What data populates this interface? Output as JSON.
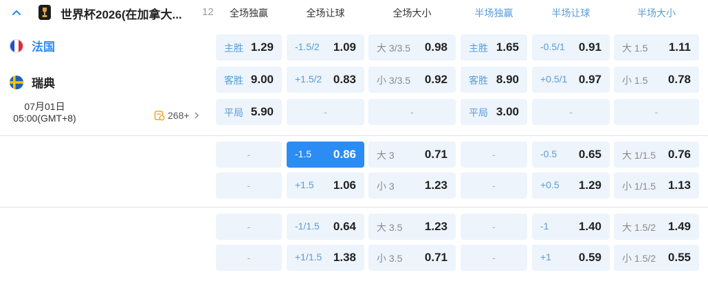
{
  "header": {
    "league": "世界杯2026(在加拿大...",
    "count": "12",
    "columns": [
      {
        "label": "全场独赢",
        "color": "#333333"
      },
      {
        "label": "全场让球",
        "color": "#333333"
      },
      {
        "label": "全场大小",
        "color": "#333333"
      },
      {
        "label": "半场独赢",
        "color": "#5b9bd5"
      },
      {
        "label": "半场让球",
        "color": "#5b9bd5"
      },
      {
        "label": "半场大小",
        "color": "#5b9bd5"
      }
    ]
  },
  "match": {
    "home": "法国",
    "away": "瑞典",
    "date": "07月01日",
    "time": "05:00(GMT+8)",
    "more_count": "268+"
  },
  "dash": "-",
  "rows": [
    [
      {
        "label": "主胜",
        "odd": "1.29"
      },
      {
        "label": "-1.5/2",
        "odd": "1.09"
      },
      {
        "label": "大 3/3.5",
        "odd": "0.98",
        "gray": true
      },
      {
        "label": "主胜",
        "odd": "1.65"
      },
      {
        "label": "-0.5/1",
        "odd": "0.91"
      },
      {
        "label": "大 1.5",
        "odd": "1.11",
        "gray": true
      }
    ],
    [
      {
        "label": "客胜",
        "odd": "9.00"
      },
      {
        "label": "+1.5/2",
        "odd": "0.83"
      },
      {
        "label": "小 3/3.5",
        "odd": "0.92",
        "gray": true
      },
      {
        "label": "客胜",
        "odd": "8.90"
      },
      {
        "label": "+0.5/1",
        "odd": "0.97"
      },
      {
        "label": "小 1.5",
        "odd": "0.78",
        "gray": true
      }
    ],
    [
      {
        "label": "平局",
        "odd": "5.90"
      },
      null,
      null,
      {
        "label": "平局",
        "odd": "3.00"
      },
      null,
      null
    ],
    [
      null,
      {
        "label": "-1.5",
        "odd": "0.86",
        "active": true
      },
      {
        "label": "大 3",
        "odd": "0.71",
        "gray": true
      },
      null,
      {
        "label": "-0.5",
        "odd": "0.65"
      },
      {
        "label": "大 1/1.5",
        "odd": "0.76",
        "gray": true
      }
    ],
    [
      null,
      {
        "label": "+1.5",
        "odd": "1.06"
      },
      {
        "label": "小 3",
        "odd": "1.23",
        "gray": true
      },
      null,
      {
        "label": "+0.5",
        "odd": "1.29"
      },
      {
        "label": "小 1/1.5",
        "odd": "1.13",
        "gray": true
      }
    ],
    [
      null,
      {
        "label": "-1/1.5",
        "odd": "0.64"
      },
      {
        "label": "大 3.5",
        "odd": "1.23",
        "gray": true
      },
      null,
      {
        "label": "-1",
        "odd": "1.40"
      },
      {
        "label": "大 1.5/2",
        "odd": "1.49",
        "gray": true
      }
    ],
    [
      null,
      {
        "label": "+1/1.5",
        "odd": "1.38"
      },
      {
        "label": "小 3.5",
        "odd": "0.71",
        "gray": true
      },
      null,
      {
        "label": "+1",
        "odd": "0.59"
      },
      {
        "label": "小 1.5/2",
        "odd": "0.55",
        "gray": true
      }
    ]
  ]
}
